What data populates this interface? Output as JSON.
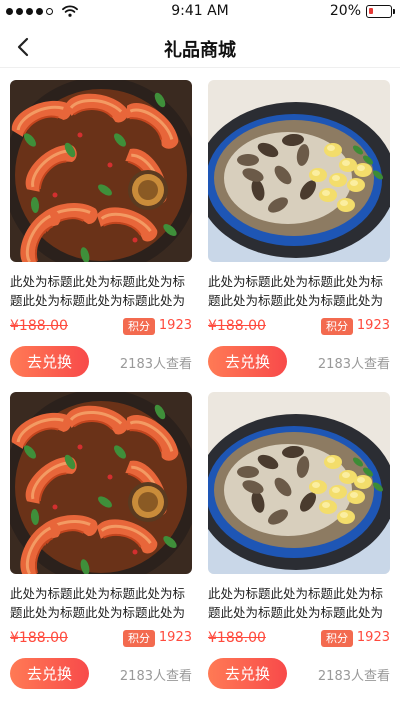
{
  "status_bar": {
    "time": "9:41 AM",
    "battery_text": "20%",
    "battery_level": 0.2,
    "signal_bars_filled": 4,
    "signal_bars_total": 5
  },
  "nav": {
    "back_icon": "chevron-left-icon",
    "title": "礼品商城"
  },
  "colors": {
    "accent": "#ff4a3d",
    "badge": "#f36a4f",
    "button_gradient_start": "#ff7a55",
    "button_gradient_end": "#f84a4a",
    "muted": "#999999"
  },
  "products": [
    {
      "image": "shrimp-dish",
      "title": "此处为标题此处为标题此处为标题此处为标题此处为标题此处为标题",
      "price": "¥188.00",
      "points_label": "积分",
      "points": "1923",
      "button": "去兑换",
      "views": "2183人查看"
    },
    {
      "image": "mushroom-gnocchi-dish",
      "title": "此处为标题此处为标题此处为标题此处为标题此处为标题此处为标题",
      "price": "¥188.00",
      "points_label": "积分",
      "points": "1923",
      "button": "去兑换",
      "views": "2183人查看"
    },
    {
      "image": "shrimp-dish",
      "title": "此处为标题此处为标题此处为标题此处为标题此处为标题此处为标题",
      "price": "¥188.00",
      "points_label": "积分",
      "points": "1923",
      "button": "去兑换",
      "views": "2183人查看"
    },
    {
      "image": "mushroom-gnocchi-dish",
      "title": "此处为标题此处为标题此处为标题此处为标题此处为标题此处为标题",
      "price": "¥188.00",
      "points_label": "积分",
      "points": "1923",
      "button": "去兑换",
      "views": "2183人查看"
    }
  ]
}
